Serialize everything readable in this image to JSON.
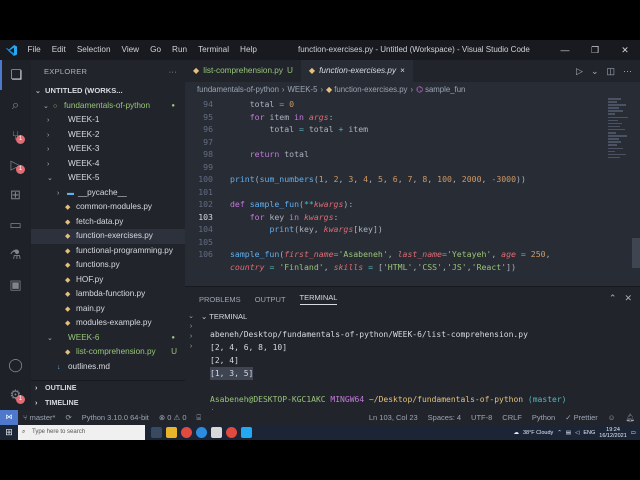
{
  "window": {
    "title": "function-exercises.py - Untitled (Workspace) - Visual Studio Code",
    "menu": [
      "File",
      "Edit",
      "Selection",
      "View",
      "Go",
      "Run",
      "Terminal",
      "Help"
    ]
  },
  "sidebar": {
    "header": "EXPLORER",
    "workspace": "UNTITLED (WORKS...",
    "root": "fundamentals-of-python",
    "items": [
      {
        "label": "WEEK-1",
        "kind": "folder"
      },
      {
        "label": "WEEK-2",
        "kind": "folder"
      },
      {
        "label": "WEEK-3",
        "kind": "folder"
      },
      {
        "label": "WEEK-4",
        "kind": "folder"
      },
      {
        "label": "WEEK-5",
        "kind": "folder-open"
      },
      {
        "label": "__pycache__",
        "kind": "folder"
      },
      {
        "label": "common-modules.py",
        "kind": "py"
      },
      {
        "label": "fetch-data.py",
        "kind": "py"
      },
      {
        "label": "function-exercises.py",
        "kind": "py"
      },
      {
        "label": "functional-programming.py",
        "kind": "py"
      },
      {
        "label": "functions.py",
        "kind": "py"
      },
      {
        "label": "HOF.py",
        "kind": "py"
      },
      {
        "label": "lambda-function.py",
        "kind": "py"
      },
      {
        "label": "main.py",
        "kind": "py"
      },
      {
        "label": "modules-example.py",
        "kind": "py"
      },
      {
        "label": "WEEK-6",
        "kind": "folder-open"
      },
      {
        "label": "list-comprehension.py",
        "kind": "py",
        "status": "U"
      },
      {
        "label": "outlines.md",
        "kind": "md"
      }
    ],
    "sections": [
      "OUTLINE",
      "TIMELINE"
    ]
  },
  "tabs": [
    {
      "label": "list-comprehension.py",
      "status": "U"
    },
    {
      "label": "function-exercises.py",
      "close": "×"
    }
  ],
  "breadcrumb": [
    "fundamentals-of-python",
    "WEEK-5",
    "function-exercises.py",
    "sample_fun"
  ],
  "editor": {
    "line_numbers": [
      "94",
      "95",
      "96",
      "97",
      "98",
      "99",
      "100",
      "101",
      "102",
      "103",
      "104",
      "105",
      "106",
      ""
    ]
  },
  "panel": {
    "tabs": [
      "PROBLEMS",
      "OUTPUT",
      "TERMINAL"
    ],
    "terminal_label": "TERMINAL",
    "lines": [
      "abeneh/Desktop/fundamentals-of-python/WEEK-6/list-comprehension.py",
      "[2, 4, 6, 8, 10]",
      "[2, 4]",
      "[1, 3, 5]",
      "",
      "$"
    ],
    "prompt": {
      "user": "Asabeneh@DESKTOP-KGC1AKC",
      "shell": "MINGW64",
      "path": "~/Desktop/fundamentals-of-python",
      "branch": "(master)"
    }
  },
  "statusbar": {
    "branch": "master*",
    "python": "Python 3.10.0 64-bit",
    "errors": "0",
    "warnings": "0",
    "position": "Ln 103, Col 23",
    "spaces": "Spaces: 4",
    "encoding": "UTF-8",
    "eol": "CRLF",
    "language": "Python",
    "formatter": "Prettier"
  },
  "taskbar": {
    "search_placeholder": "Type here to search",
    "weather": "38°F Cloudy",
    "lang": "ENG",
    "time": "19:24",
    "date": "16/12/2021"
  },
  "colors": {
    "accent": "#4d78cc",
    "editor_bg": "#282c34",
    "sidebar_bg": "#21252b",
    "keyword": "#c678dd",
    "function": "#61afef",
    "number": "#d19a66",
    "string": "#98c379"
  }
}
